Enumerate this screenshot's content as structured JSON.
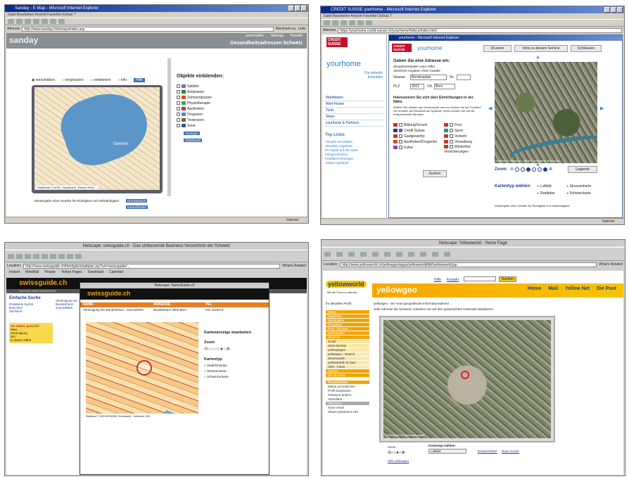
{
  "sanday": {
    "title": "Sanday - E-Map - Microsoft Internet Explorer",
    "menu": "Datei   Bearbeiten   Ansicht   Favoriten   Extras   ?",
    "address_label": "Adresse",
    "url": "http://www.sanday.ch/emaps/index.asp",
    "go": "Wechseln zu",
    "links": "Links",
    "brand": "sanday",
    "top_links": [
      "umschalten",
      "Sitemap",
      "Kontakt"
    ],
    "header_title": "Gesundheitsadressen Schweiz",
    "radios": [
      "verschieben",
      "vergrössern",
      "verkleinern",
      "info"
    ],
    "radio_button": "Hilfe",
    "map_label": "Geneve",
    "map_copyright": "Stadtkarte © AGIS - Basiskarte. Weitere Infos ...",
    "objects_title": "Objekte einblenden:",
    "objects": [
      {
        "label": "Spitäler",
        "color": "#9b59b6"
      },
      {
        "label": "Arztpraxen",
        "color": "#1e8f3a"
      },
      {
        "label": "Zahnarztpraxen",
        "color": "#d35400"
      },
      {
        "label": "Physiotherapie",
        "color": "#27ae60"
      },
      {
        "label": "Apotheken",
        "color": "#c0392b"
      },
      {
        "label": "Drogerien",
        "color": "#2c9ec7"
      },
      {
        "label": "Tierpraxen",
        "color": "#8e5a2a"
      },
      {
        "label": "Suva",
        "color": "#2b5a9b"
      }
    ],
    "obj_buttons": [
      "Anzeigen",
      "Objektwahl"
    ],
    "map_note": "Wiedergabe ohne Gewähr für Richtigkeit und Vollständigkeit",
    "print_buttons": [
      "Druckversion",
      "Kartenfenster"
    ],
    "status_right": "Internet"
  },
  "yourhome": {
    "title": "CREDIT SUISSE yourhome - Microsoft Internet Explorer",
    "menu": "Datei   Bearbeiten   Ansicht   Favoriten   Extras   ?",
    "address_label": "Adresse",
    "url": "https://yourhome.credit-suisse.ch/yourhome/htdocs/index.html",
    "popup_title": "yourhome - Microsoft Internet Explorer",
    "logo": "CREDIT SUISSE",
    "brand_small": "yourhome",
    "brand_big": "yourhome",
    "brand_sub": "Die aktuelle Immobilie",
    "nav": [
      "Marktdaten",
      "Wert-Finder",
      "Tools",
      "News",
      "yourhome & Partners"
    ],
    "top_links_title": "Top Links",
    "top_links": [
      "Aktuelle Immobilien",
      "Aktuellen Angebote",
      "Ihr Objekt auf der Karte",
      "Zinsgeschichten",
      "Kreditberechnungen",
      "Online-Hypothek"
    ],
    "buttons": [
      "Drucken",
      "Infos zu diesem Service",
      "Schliessen"
    ],
    "form_title": "Geben Sie eine Adresse ein:",
    "form_hint": "(Eingabebeispiele unter  Hilfe)",
    "form_hint2": "Sämtliche Angaben ohne Gewähr",
    "street_label": "Strasse",
    "street_value": "Bundesplatz",
    "nr_label": "Nr.",
    "plz_label": "PLZ",
    "plz_value": "3011",
    "ort_label": "Ort",
    "ort_value": "Bern",
    "near_title": "Interessieren Sie sich über Einrichtungen in der Nähe:",
    "near_text": "Wählen Sie einfach das Gewünschte aus und klicken Sie auf \"Suchen\". Sie erhalten die Resultate als Symbole. Wenn können Sie auf die entsprechende Adresse!",
    "near_left": [
      {
        "label": "Bildung/Schule",
        "color": "#c0392b",
        "checked": false
      },
      {
        "label": "Credit Suisse",
        "color": "#1f3e8f",
        "checked": true
      },
      {
        "label": "Gastgewerbe",
        "color": "#c0392b",
        "checked": false
      },
      {
        "label": "Apotheken/Drogerien",
        "color": "#d35400",
        "checked": false
      },
      {
        "label": "Kultur",
        "color": "#8e44ad",
        "checked": false
      }
    ],
    "near_right": [
      {
        "label": "Post",
        "color": "#c0392b",
        "checked": false
      },
      {
        "label": "Sport",
        "color": "#16a085",
        "checked": false
      },
      {
        "label": "Verkehr",
        "color": "#c0392b",
        "checked": false
      },
      {
        "label": "Verwaltung",
        "color": "#c0392b",
        "checked": false
      },
      {
        "label": "Winterthur Versicherungen",
        "color": "#c0392b",
        "checked": false
      }
    ],
    "search_button": "Suchen",
    "map_copyright": "Stadtplan © Swisstopo, Luftbild © Swissphoto, Bundesamt...",
    "zoom_label": "Zoom:",
    "legend_button": "Legende",
    "kartentyp_label": "Kartentyp wählen:",
    "map_types": [
      "Luftbild",
      "Strassenkarte",
      "Stadtplan",
      "Schwarzkarte"
    ],
    "map_note": "Wiedergabe ohne Gewähr für Richtigkeit und Vollständigkeit",
    "status_right": "Internet"
  },
  "swissguide": {
    "title": "Netscape: swissguide.ch - Das umfassende Business-Verzeichnis der Schweiz",
    "location_label": "Location:",
    "url": "http://www.swissguide.ch/html/gde/stadtplan.jsp?url=/swissguide/...",
    "whats_related": "What's Related",
    "bookmarks": [
      "Instant",
      "WebMail",
      "People",
      "Yellow Pages",
      "Download",
      "Calendar"
    ],
    "brand": "swissguide.ch",
    "subheader": "SUCHEN NACH BRANCHEN",
    "popup_title": "Netscape: SwissGuide.ch",
    "left_title": "Einfache Suche",
    "left_links": [
      "Erweiterte Suche",
      "Branchen",
      "Stichwort"
    ],
    "results_title": "Sie haben gesucht:",
    "results": [
      "Was:",
      "Vereinigung",
      "Wo:",
      "In dieser Nähe"
    ],
    "table_headers": [
      "NAME",
      "ADRESSE",
      "TEL"
    ],
    "row_name": "Vereinigung der Bundeshaus - Journalisten",
    "row_address": "Bundeshaus 3003 Bern",
    "row_tel": "031 3119471",
    "left_row_name": "Vereinigung der Bundeshaus Journalisten",
    "map_title": "Kartenanzeige bearbeiten",
    "zoom_label": "Zoom",
    "kartentyp_label": "Kartentyp",
    "map_types": [
      "Stadt/Ortsplan",
      "Strassenkarte",
      "Schweizerkarte"
    ],
    "map_copyright": "Stadtplan © 1994 BD052881, Bundesamt... Bahnplan 2001",
    "map_label": "Aare"
  },
  "yellowworld": {
    "title": "Netscape: Yellowworld - Home Page",
    "toolbar": [
      "Back",
      "Forward",
      "Reload",
      "Home",
      "Search",
      "Netscape",
      "Images",
      "Print",
      "Security",
      "Shop",
      "Stop"
    ],
    "location_label": "Location:",
    "url": "http://www.yellowworld.ch/yellowgeo/apps/yellowworld/dhf/yellowworld.jsp",
    "whats_related": "What's Related",
    "brand": "yellowworld",
    "brand_sub": "Mit der Post ins Internet",
    "hero": "yellowgeo",
    "top_links": [
      "Hilfe",
      "Kontakt"
    ],
    "search_button": "Suchen",
    "main_nav": [
      "Home",
      "Mail",
      "Yellow Net",
      "Die Post"
    ],
    "profile": "Ihr aktuelles Profil:",
    "left_nav": [
      "News",
      "Magazine",
      "Marktplätze",
      "Shopping",
      "Post - Dienste",
      "Veranstalter",
      "Services",
      "Email",
      "SMS Dienste",
      "yellowpages",
      "yellowgeo - Search",
      "Zeremoniell",
      "yellowworld.ch Nutz",
      "Hilfe - Fotos",
      "Games",
      "Mit der Post"
    ],
    "personal_title": "Persönliches",
    "personal": [
      "Meine persönlichen",
      "Profil bearbeiten",
      "Passwort ändern",
      "Abmelden",
      "Abmelden",
      "Neue email",
      "Stand unbekannt 100"
    ],
    "intro_title": "yellowgeo - der neue geografische Informationsdienst",
    "intro_text": "Jede Adresse der Schweiz! Adressen Sie auf den gewünschten Kartenteil lokalisieren",
    "map_copyright": "© Bundesamt für Landestopographie",
    "zoom_label": "Zoom",
    "kartentyp_label": "Kartentyp wählen:",
    "kartentyp_value": "Luftbild",
    "links": [
      "Erweiterbilder",
      "Neue Suche"
    ],
    "help_link": "Hilfe yellowgeo"
  }
}
